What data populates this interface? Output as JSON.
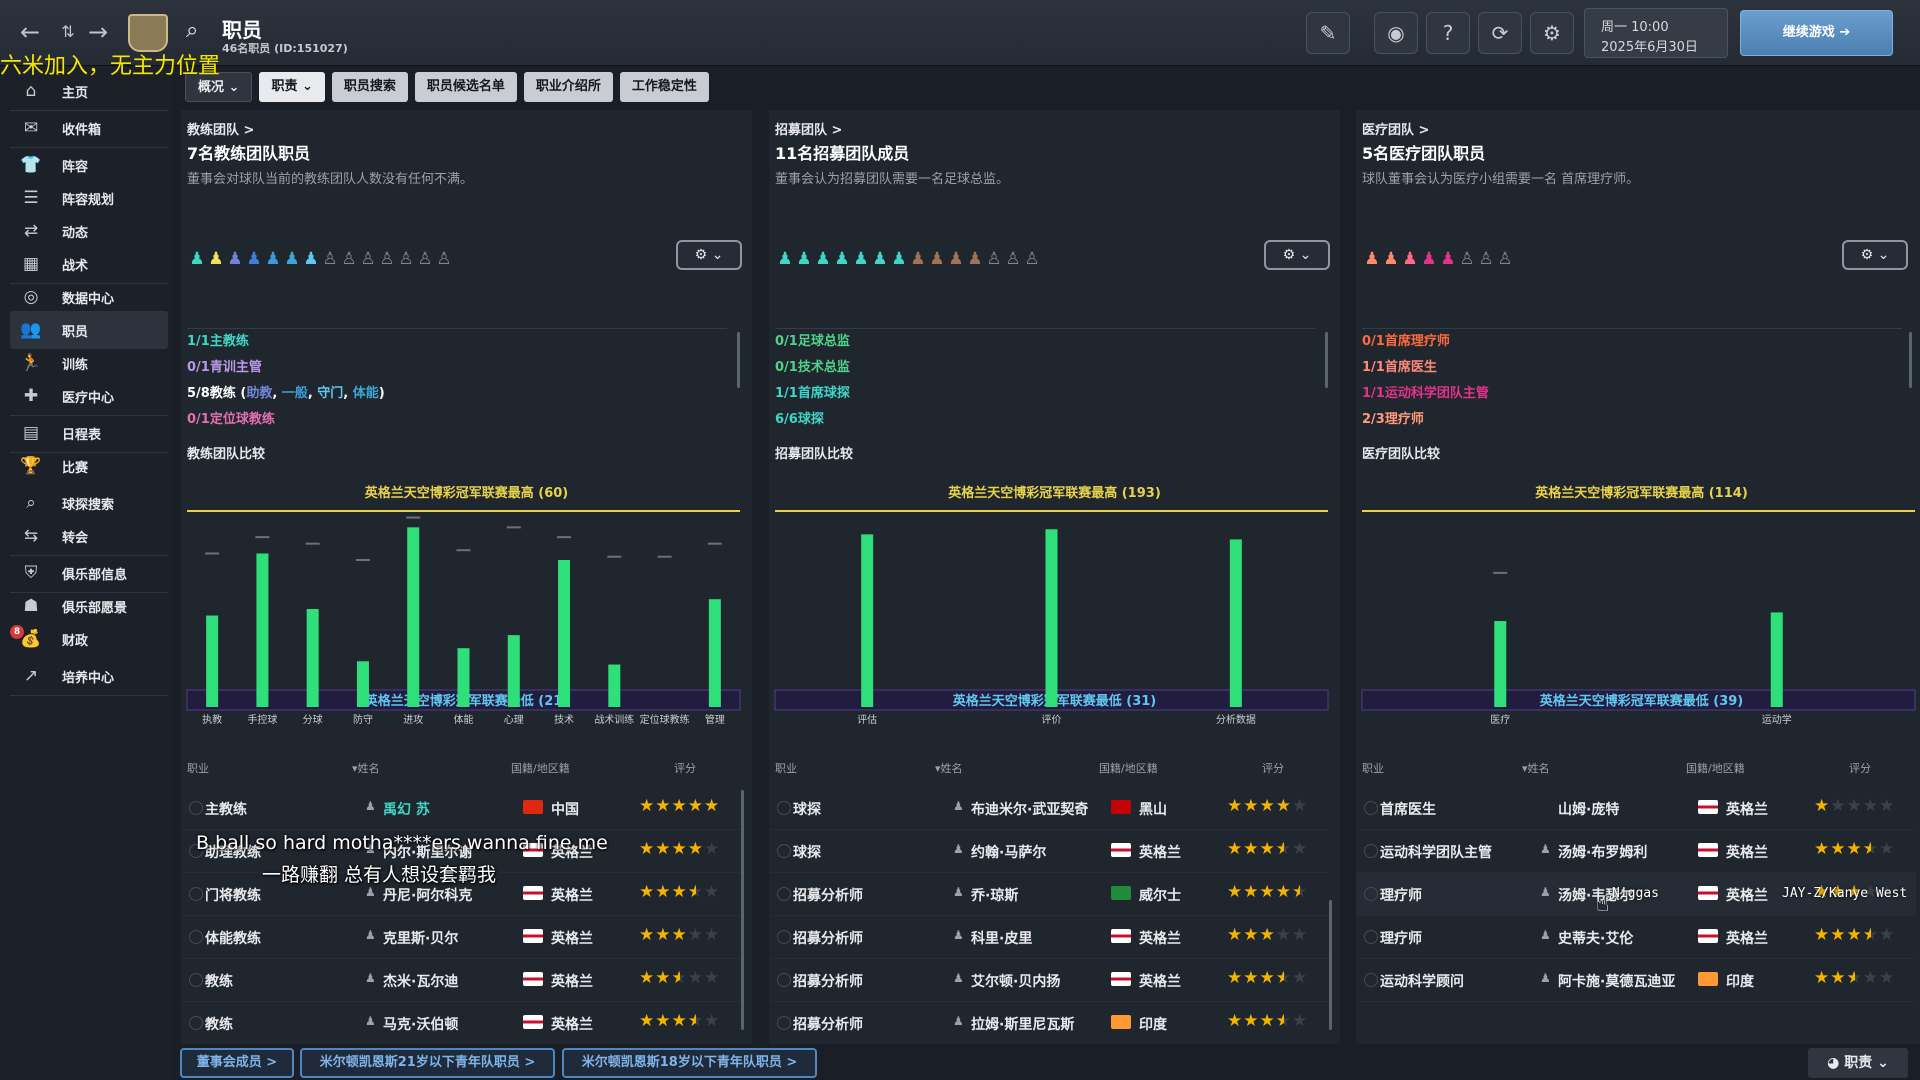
{
  "header": {
    "title": "职员",
    "subtitle": "46名职员 (ID:151027)",
    "day_time": "周一 10:00",
    "date": "2025年6月30日",
    "continue_label": "继续游戏"
  },
  "overlay": {
    "top_text": "六米加入，无主力位置",
    "lyric_line1": "B ball so hard motha****ers wanna fine me",
    "lyric_line2": "一路赚翻 总有人想设套羁我",
    "lyric_line3": "Niggas",
    "lyric_line4": "JAY-Z/Kanye West"
  },
  "sidebar": {
    "items": [
      {
        "label": "主页",
        "icon": "home-icon"
      },
      {
        "label": "收件箱",
        "icon": "inbox-icon"
      },
      {
        "label": "阵容",
        "icon": "squad-icon"
      },
      {
        "label": "阵容规划",
        "icon": "squad-planner-icon"
      },
      {
        "label": "动态",
        "icon": "dynamics-icon"
      },
      {
        "label": "战术",
        "icon": "tactics-icon"
      },
      {
        "label": "数据中心",
        "icon": "data-hub-icon"
      },
      {
        "label": "职员",
        "icon": "staff-icon"
      },
      {
        "label": "训练",
        "icon": "training-icon"
      },
      {
        "label": "医疗中心",
        "icon": "medical-icon"
      },
      {
        "label": "日程表",
        "icon": "calendar-icon"
      },
      {
        "label": "比赛",
        "icon": "trophy-icon"
      },
      {
        "label": "球探搜索",
        "icon": "search-icon"
      },
      {
        "label": "转会",
        "icon": "transfer-icon"
      },
      {
        "label": "俱乐部信息",
        "icon": "shield-icon"
      },
      {
        "label": "俱乐部愿景",
        "icon": "vision-icon"
      },
      {
        "label": "财政",
        "icon": "finance-icon"
      },
      {
        "label": "培养中心",
        "icon": "development-icon"
      }
    ],
    "badge": "8"
  },
  "tabs": [
    "概况",
    "职责",
    "职员搜索",
    "职员候选名单",
    "职业介绍所",
    "工作稳定性"
  ],
  "panels": [
    {
      "link": "教练团队 >",
      "title": "7名教练团队职员",
      "desc": "董事会对球队当前的教练团队人数没有任何不满。",
      "roles": [
        {
          "text": "1/1主教练",
          "color": "#3fd6c8"
        },
        {
          "text": "0/1青训主管",
          "color": "#b89ae8"
        },
        {
          "text": "0/1定位球教练",
          "color": "#e36fb0"
        }
      ],
      "coach_line": {
        "prefix": "5/8教练 (",
        "a": "助教",
        "b": "一般",
        "c": "守门",
        "d": "体能",
        "suffix": ")"
      },
      "compare_title": "教练团队比较",
      "top_label": "英格兰天空博彩冠军联赛最高 (60)",
      "bottom_label": "英格兰天空博彩冠军联赛最低 (21)",
      "headers": {
        "job": "职业",
        "name": "▾姓名",
        "nation": "国籍/地区籍",
        "rating": "评分"
      }
    },
    {
      "link": "招募团队 >",
      "title": "11名招募团队成员",
      "desc": "董事会认为招募团队需要一名足球总监。",
      "roles": [
        {
          "text": "0/1足球总监",
          "color": "#4fd38a"
        },
        {
          "text": "0/1技术总监",
          "color": "#4fd38a"
        },
        {
          "text": "1/1首席球探",
          "color": "#3fd6c8"
        },
        {
          "text": "6/6球探",
          "color": "#3fd6c8"
        }
      ],
      "compare_title": "招募团队比较",
      "top_label": "英格兰天空博彩冠军联赛最高 (193)",
      "bottom_label": "英格兰天空博彩冠军联赛最低 (31)",
      "headers": {
        "job": "职业",
        "name": "▾姓名",
        "nation": "国籍/地区籍",
        "rating": "评分"
      }
    },
    {
      "link": "医疗团队 >",
      "title": "5名医疗团队职员",
      "desc": "球队董事会认为医疗小组需要一名 首席理疗师。",
      "roles": [
        {
          "text": "0/1首席理疗师",
          "color": "#ff6a3d"
        },
        {
          "text": "1/1首席医生",
          "color": "#ff8a7a"
        },
        {
          "text": "1/1运动科学团队主管",
          "color": "#e0338a"
        },
        {
          "text": "2/3理疗师",
          "color": "#ff9a7a"
        }
      ],
      "compare_title": "医疗团队比较",
      "top_label": "英格兰天空博彩冠军联赛最高 (114)",
      "bottom_label": "英格兰天空博彩冠军联赛最低 (39)",
      "headers": {
        "job": "职业",
        "name": "▾姓名",
        "nation": "国籍/地区籍",
        "rating": "评分"
      }
    }
  ],
  "chart_data": [
    {
      "type": "bar",
      "categories": [
        "执教",
        "手控球",
        "分球",
        "防守",
        "进攻",
        "体能",
        "心理",
        "技术",
        "战术训练",
        "定位球教练",
        "管理"
      ],
      "values": [
        28,
        47,
        30,
        14,
        55,
        18,
        22,
        45,
        13,
        0,
        33
      ],
      "marker": [
        47,
        52,
        50,
        45,
        58,
        48,
        55,
        52,
        46,
        46,
        50
      ],
      "ylim": [
        21,
        60
      ],
      "color": "#2fe07a"
    },
    {
      "type": "bar",
      "categories": [
        "评估",
        "评价",
        "分析数据"
      ],
      "values": [
        170,
        175,
        165
      ],
      "ylim": [
        31,
        193
      ],
      "color": "#2fe07a"
    },
    {
      "type": "bar",
      "categories": [
        "医疗",
        "运动学"
      ],
      "values": [
        50,
        55
      ],
      "marker": [
        78
      ],
      "ylim": [
        39,
        114
      ],
      "color": "#2fe07a"
    }
  ],
  "staff_tables": [
    [
      {
        "job": "主教练",
        "name": "禹幻 苏",
        "nation": "中国",
        "flag": "#de2910",
        "stars": 5,
        "highlight": true
      },
      {
        "job": "助理教练",
        "name": "内尔·斯里尔谢",
        "nation": "英格兰",
        "flag": "#ffffff",
        "stars": 4
      },
      {
        "job": "门将教练",
        "name": "丹尼·阿尔科克",
        "nation": "英格兰",
        "flag": "#ffffff",
        "stars": 3.5
      },
      {
        "job": "体能教练",
        "name": "克里斯·贝尔",
        "nation": "英格兰",
        "flag": "#ffffff",
        "stars": 3
      },
      {
        "job": "教练",
        "name": "杰米·瓦尔迪",
        "nation": "英格兰",
        "flag": "#ffffff",
        "stars": 2.5
      },
      {
        "job": "教练",
        "name": "马克·沃伯顿",
        "nation": "英格兰",
        "flag": "#ffffff",
        "stars": 3.5
      }
    ],
    [
      {
        "job": "球探",
        "name": "布迪米尔·武亚契奇",
        "nation": "黑山",
        "flag": "#c40308",
        "stars": 4
      },
      {
        "job": "球探",
        "name": "约翰·马萨尔",
        "nation": "英格兰",
        "flag": "#ffffff",
        "stars": 3.5
      },
      {
        "job": "招募分析师",
        "name": "乔·琼斯",
        "nation": "威尔士",
        "flag": "#1e8c3a",
        "stars": 4.5
      },
      {
        "job": "招募分析师",
        "name": "科里·皮里",
        "nation": "英格兰",
        "flag": "#ffffff",
        "stars": 3
      },
      {
        "job": "招募分析师",
        "name": "艾尔顿·贝内扬",
        "nation": "英格兰",
        "flag": "#ffffff",
        "stars": 3.5
      },
      {
        "job": "招募分析师",
        "name": "拉姆·斯里尼瓦斯",
        "nation": "印度",
        "flag": "#ff9933",
        "stars": 3.5
      }
    ],
    [
      {
        "job": "首席医生",
        "name": "山姆·庞特",
        "nation": "英格兰",
        "flag": "#ffffff",
        "stars": 1,
        "no_icon": true
      },
      {
        "job": "运动科学团队主管",
        "name": "汤姆·布罗姆利",
        "nation": "英格兰",
        "flag": "#ffffff",
        "stars": 3.5
      },
      {
        "job": "理疗师",
        "name": "汤姆·韦瑟尔",
        "nation": "英格兰",
        "flag": "#ffffff",
        "stars": 3
      },
      {
        "job": "理疗师",
        "name": "史蒂夫·艾伦",
        "nation": "英格兰",
        "flag": "#ffffff",
        "stars": 3.5
      },
      {
        "job": "运动科学顾问",
        "name": "阿卡施·莫德瓦迪亚",
        "nation": "印度",
        "flag": "#ff9933",
        "stars": 2.5
      }
    ]
  ],
  "bottom": {
    "board_btn": "董事会成员 >",
    "u21_btn": "米尔顿凯恩斯21岁以下青年队职员 >",
    "u18_btn": "米尔顿凯恩斯18岁以下青年队职员 >",
    "staff_btn": "职责"
  },
  "person_icons": [
    [
      "#3fd6c8",
      "#f2e25a",
      "#6f86d8",
      "#3d7fd8",
      "#3d9ad8",
      "#3da6d8",
      "#5fc8f0",
      "off",
      "off",
      "off",
      "off",
      "off",
      "off",
      "off"
    ],
    [
      "#3fd6c8",
      "#3fd6c8",
      "#3fd6c8",
      "#3fd6c8",
      "#3fd6c8",
      "#3fd6c8",
      "#3fd6c8",
      "#a0725a",
      "#a0725a",
      "#a0725a",
      "#a0725a",
      "off",
      "off",
      "off"
    ],
    [
      "#ff8a6a",
      "#ff8a6a",
      "#ff6a8a",
      "#e0338a",
      "#e0338a",
      "off",
      "off",
      "off"
    ]
  ]
}
